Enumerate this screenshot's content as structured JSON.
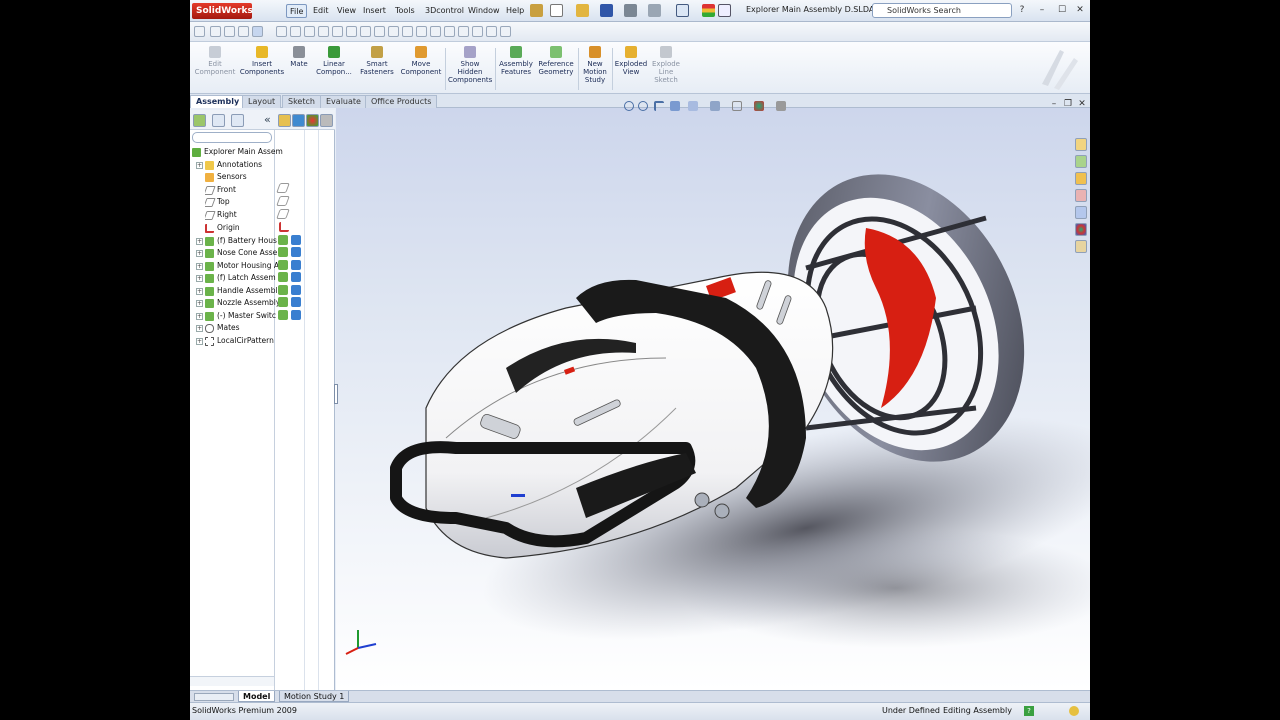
{
  "app": {
    "logo_text": "SolidWorks",
    "document_title": "Explorer Main Assembly D.SLDASM"
  },
  "menu": [
    "File",
    "Edit",
    "View",
    "Insert",
    "Tools",
    "3Dcontrol",
    "Window",
    "Help"
  ],
  "search": {
    "placeholder": "SolidWorks Search"
  },
  "window_controls": [
    "?",
    "–",
    "☐",
    "✕"
  ],
  "command_manager": {
    "items": [
      {
        "label": "Edit\nComponent",
        "icon": "edit-component-icon",
        "enabled": false
      },
      {
        "label": "Insert\nComponents",
        "icon": "insert-components-icon",
        "enabled": true
      },
      {
        "label": "Mate",
        "icon": "mate-icon",
        "enabled": true
      },
      {
        "label": "Linear\nCompon...",
        "icon": "linear-pattern-icon",
        "enabled": true
      },
      {
        "label": "Smart\nFasteners",
        "icon": "smart-fasteners-icon",
        "enabled": true
      },
      {
        "label": "Move\nComponent",
        "icon": "move-component-icon",
        "enabled": true
      },
      {
        "label": "Show\nHidden\nComponents",
        "icon": "show-hidden-icon",
        "enabled": true
      },
      {
        "label": "Assembly\nFeatures",
        "icon": "assembly-features-icon",
        "enabled": true
      },
      {
        "label": "Reference\nGeometry",
        "icon": "reference-geometry-icon",
        "enabled": true
      },
      {
        "label": "New\nMotion\nStudy",
        "icon": "motion-study-icon",
        "enabled": true
      },
      {
        "label": "Exploded\nView",
        "icon": "exploded-view-icon",
        "enabled": true
      },
      {
        "label": "Explode\nLine\nSketch",
        "icon": "explode-line-icon",
        "enabled": false
      }
    ]
  },
  "tabs": [
    "Assembly",
    "Layout",
    "Sketch",
    "Evaluate",
    "Office Products"
  ],
  "active_tab": "Assembly",
  "feature_tree": {
    "root": "Explorer Main Assem",
    "nodes": [
      {
        "label": "Annotations",
        "icon": "annotations-icon",
        "expandable": true
      },
      {
        "label": "Sensors",
        "icon": "sensors-icon",
        "expandable": false
      },
      {
        "label": "Front",
        "icon": "plane-icon",
        "expandable": false
      },
      {
        "label": "Top",
        "icon": "plane-icon",
        "expandable": false
      },
      {
        "label": "Right",
        "icon": "plane-icon",
        "expandable": false
      },
      {
        "label": "Origin",
        "icon": "origin-icon",
        "expandable": false
      },
      {
        "label": "(f) Battery Hous",
        "icon": "subassembly-icon",
        "expandable": true
      },
      {
        "label": "Nose Cone Asse",
        "icon": "subassembly-icon",
        "expandable": true
      },
      {
        "label": "Motor Housing A",
        "icon": "subassembly-icon",
        "expandable": true
      },
      {
        "label": "(f) Latch Assem",
        "icon": "subassembly-icon",
        "expandable": true
      },
      {
        "label": "Handle Assembl",
        "icon": "subassembly-icon",
        "expandable": true
      },
      {
        "label": "Nozzle Assembly",
        "icon": "subassembly-icon",
        "expandable": true
      },
      {
        "label": "(-) Master Switc",
        "icon": "subassembly-icon",
        "expandable": true
      },
      {
        "label": "Mates",
        "icon": "mates-icon",
        "expandable": true
      },
      {
        "label": "LocalCirPattern",
        "icon": "circular-pattern-icon",
        "expandable": true
      }
    ]
  },
  "bottom_tabs": [
    "Model",
    "Motion Study 1"
  ],
  "status": {
    "app_name": "SolidWorks Premium 2009",
    "definition": "Under Defined",
    "mode": "Editing Assembly"
  },
  "colors": {
    "accent_red": "#d71f12",
    "body_white": "#ffffff",
    "handle_black": "#1a1a1a",
    "viewport_top": "#cdd6ec"
  }
}
